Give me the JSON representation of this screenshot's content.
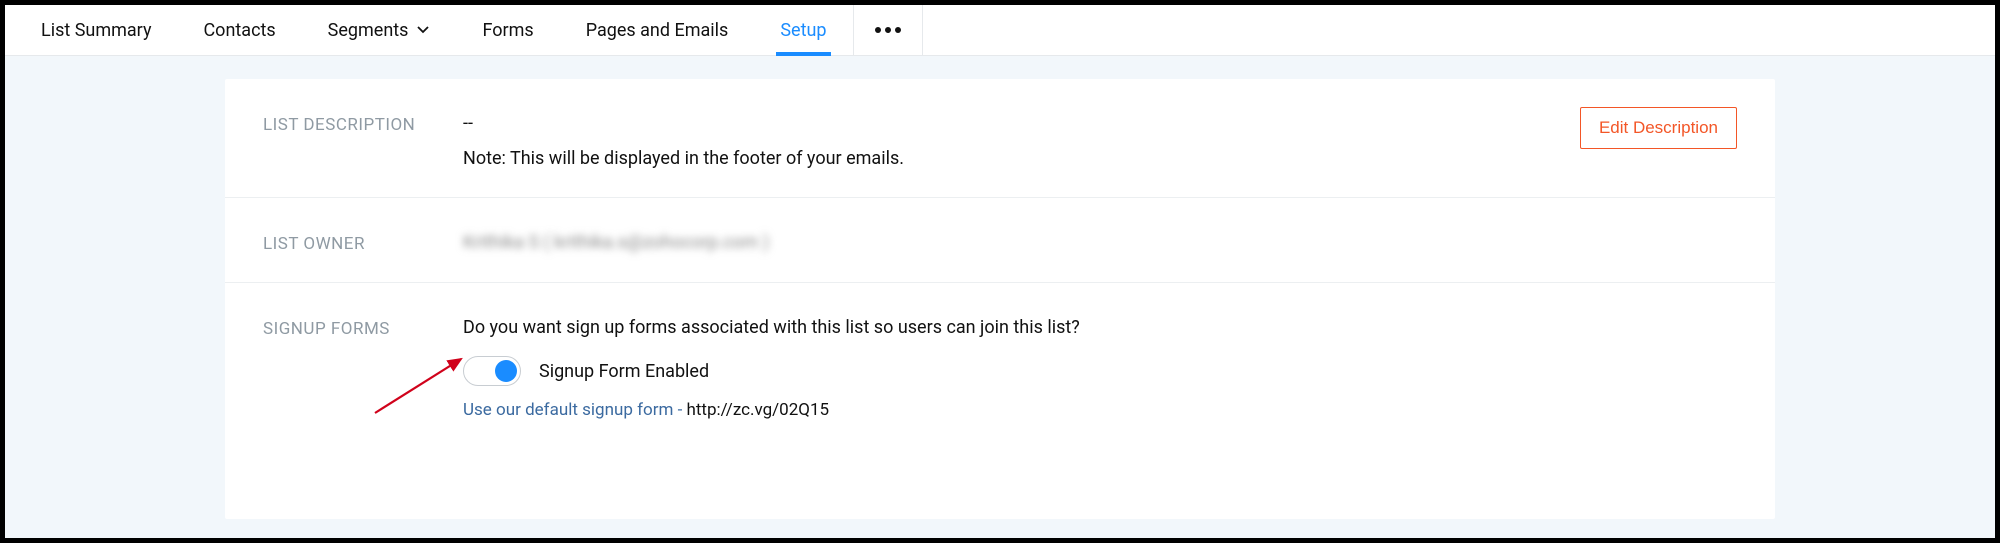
{
  "tabs": {
    "list_summary": "List Summary",
    "contacts": "Contacts",
    "segments": "Segments",
    "forms": "Forms",
    "pages_emails": "Pages and Emails",
    "setup": "Setup"
  },
  "list_description": {
    "label": "LIST DESCRIPTION",
    "value": "--",
    "note": "Note: This will be displayed in the footer of your emails.",
    "edit_btn": "Edit Description"
  },
  "list_owner": {
    "label": "LIST OWNER",
    "value_masked": "Krithika S ( krithika.s@zohocorp.com )"
  },
  "signup_forms": {
    "label": "SIGNUP FORMS",
    "question": "Do you want sign up forms associated with this list so users can join this list?",
    "toggle_label": "Signup Form Enabled",
    "default_link_text": "Use our default signup form - ",
    "default_link_url": "http://zc.vg/02Q15"
  }
}
